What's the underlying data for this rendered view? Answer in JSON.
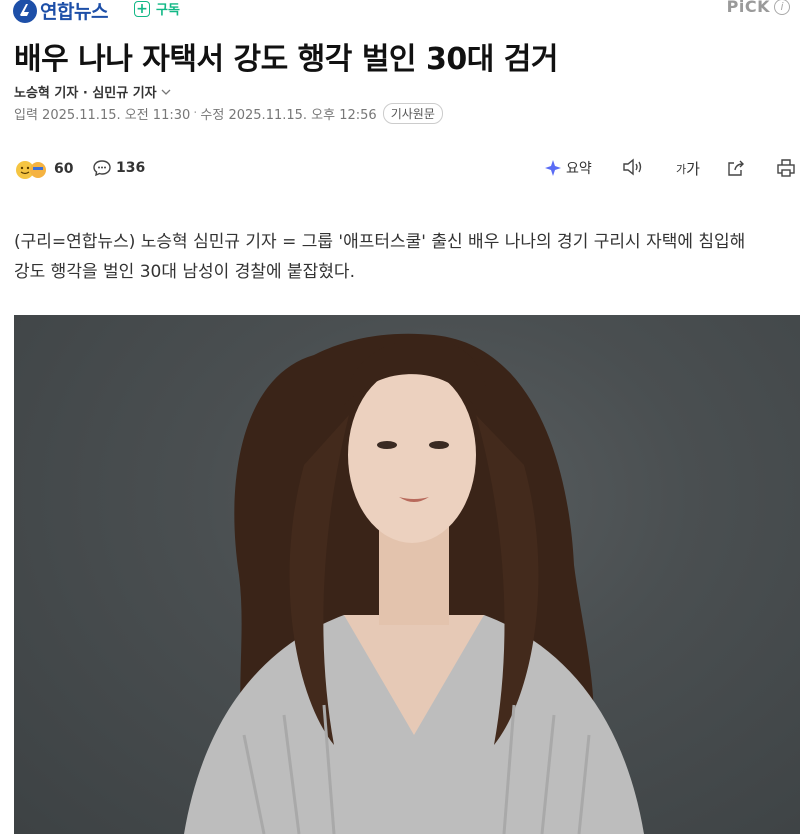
{
  "press": {
    "name": "연합뉴스",
    "subscribe_label": "구독",
    "pick_label": "PiCK"
  },
  "article": {
    "headline": "배우 나나 자택서 강도 행각 벌인 30대 검거",
    "byline": "노승혁 기자 · 심민규 기자",
    "published": "입력 2025.11.15. 오전 11:30",
    "modified": "수정 2025.11.15. 오후 12:56",
    "original_label": "기사원문",
    "lead_line1": "(구리=연합뉴스) 노승혁 심민규 기자 = 그룹 '애프터스쿨' 출신 배우 나나의 경기 구리시 자택에 침입해",
    "lead_line2": "강도 행각을 벌인 30대 남성이 경찰에 붙잡혔다."
  },
  "toolbar": {
    "reaction_count": "60",
    "comment_count": "136",
    "summary_label": "요약",
    "font_label": "가가"
  },
  "icons": [
    "yonhap-logo-icon",
    "plus-icon",
    "info-icon",
    "chevron-down-icon",
    "reaction-emoji-icon",
    "comment-icon",
    "summary-sparkle-icon",
    "speaker-icon",
    "font-size-icon",
    "share-icon",
    "print-icon"
  ],
  "colors": {
    "brand": "#1d4fa8",
    "subscribe": "#12b886",
    "photo_bg": "#4a4f51"
  }
}
